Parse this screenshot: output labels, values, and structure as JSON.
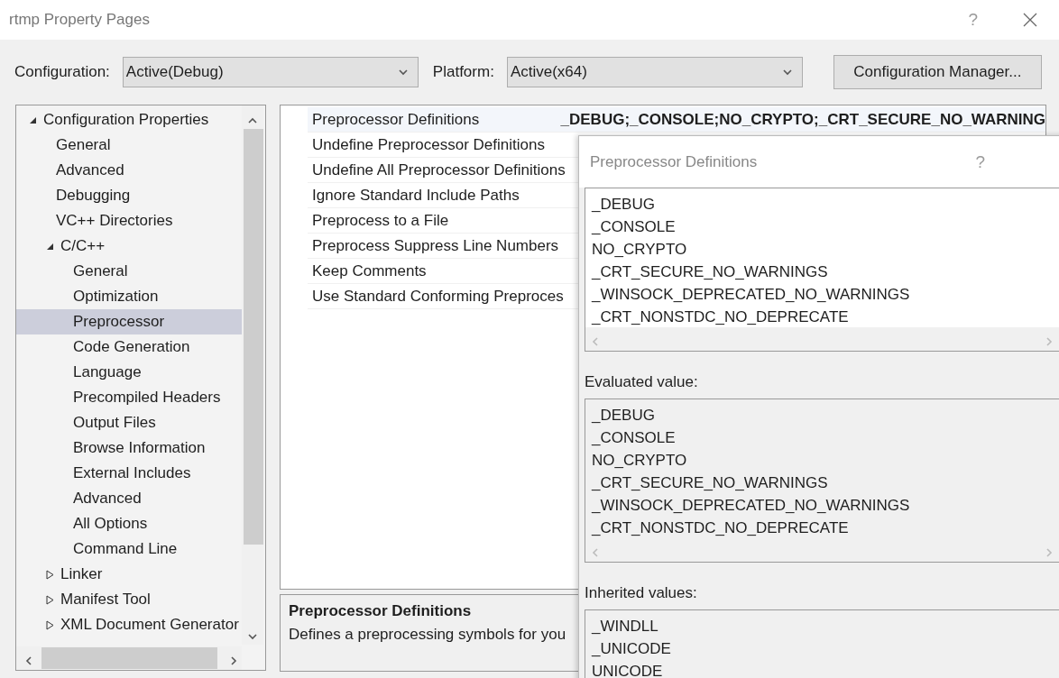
{
  "window": {
    "title": "rtmp Property Pages",
    "help": "?"
  },
  "toolbar": {
    "configuration_label": "Configuration:",
    "configuration": "Active(Debug)",
    "platform_label": "Platform:",
    "platform": "Active(x64)",
    "manager_button": "Configuration Manager..."
  },
  "tree": [
    {
      "label": "Configuration Properties",
      "expanded": true,
      "selected": false,
      "children": [
        {
          "label": "General",
          "selected": false
        },
        {
          "label": "Advanced",
          "selected": false
        },
        {
          "label": "Debugging",
          "selected": false
        },
        {
          "label": "VC++ Directories",
          "selected": false
        },
        {
          "label": "C/C++",
          "expanded": true,
          "selected": false,
          "children": [
            {
              "label": "General",
              "selected": false
            },
            {
              "label": "Optimization",
              "selected": false
            },
            {
              "label": "Preprocessor",
              "selected": true
            },
            {
              "label": "Code Generation",
              "selected": false
            },
            {
              "label": "Language",
              "selected": false
            },
            {
              "label": "Precompiled Headers",
              "selected": false
            },
            {
              "label": "Output Files",
              "selected": false
            },
            {
              "label": "Browse Information",
              "selected": false
            },
            {
              "label": "External Includes",
              "selected": false
            },
            {
              "label": "Advanced",
              "selected": false
            },
            {
              "label": "All Options",
              "selected": false
            },
            {
              "label": "Command Line",
              "selected": false
            }
          ]
        },
        {
          "label": "Linker",
          "expanded": false,
          "selected": false
        },
        {
          "label": "Manifest Tool",
          "expanded": false,
          "selected": false
        },
        {
          "label": "XML Document Generator",
          "expanded": false,
          "selected": false
        }
      ]
    }
  ],
  "properties": [
    {
      "name": "Preprocessor Definitions",
      "value": "_DEBUG;_CONSOLE;NO_CRYPTO;_CRT_SECURE_NO_WARNING",
      "selected": true
    },
    {
      "name": "Undefine Preprocessor Definitions",
      "selected": false
    },
    {
      "name": "Undefine All Preprocessor Definitions",
      "selected": false
    },
    {
      "name": "Ignore Standard Include Paths",
      "selected": false
    },
    {
      "name": "Preprocess to a File",
      "selected": false
    },
    {
      "name": "Preprocess Suppress Line Numbers",
      "selected": false
    },
    {
      "name": "Keep Comments",
      "selected": false
    },
    {
      "name": "Use Standard Conforming Preproces",
      "selected": false
    }
  ],
  "description": {
    "title": "Preprocessor Definitions",
    "text": "Defines a preprocessing symbols for you"
  },
  "dialog": {
    "title": "Preprocessor Definitions",
    "help": "?",
    "definitions": [
      "_DEBUG",
      "_CONSOLE",
      "NO_CRYPTO",
      "_CRT_SECURE_NO_WARNINGS",
      "_WINSOCK_DEPRECATED_NO_WARNINGS",
      "_CRT_NONSTDC_NO_DEPRECATE"
    ],
    "evaluated_label": "Evaluated value:",
    "evaluated": [
      "_DEBUG",
      "_CONSOLE",
      "NO_CRYPTO",
      "_CRT_SECURE_NO_WARNINGS",
      "_WINSOCK_DEPRECATED_NO_WARNINGS",
      "_CRT_NONSTDC_NO_DEPRECATE"
    ],
    "inherited_label": "Inherited values:",
    "inherited": [
      "_WINDLL",
      "_UNICODE",
      "UNICODE"
    ]
  }
}
